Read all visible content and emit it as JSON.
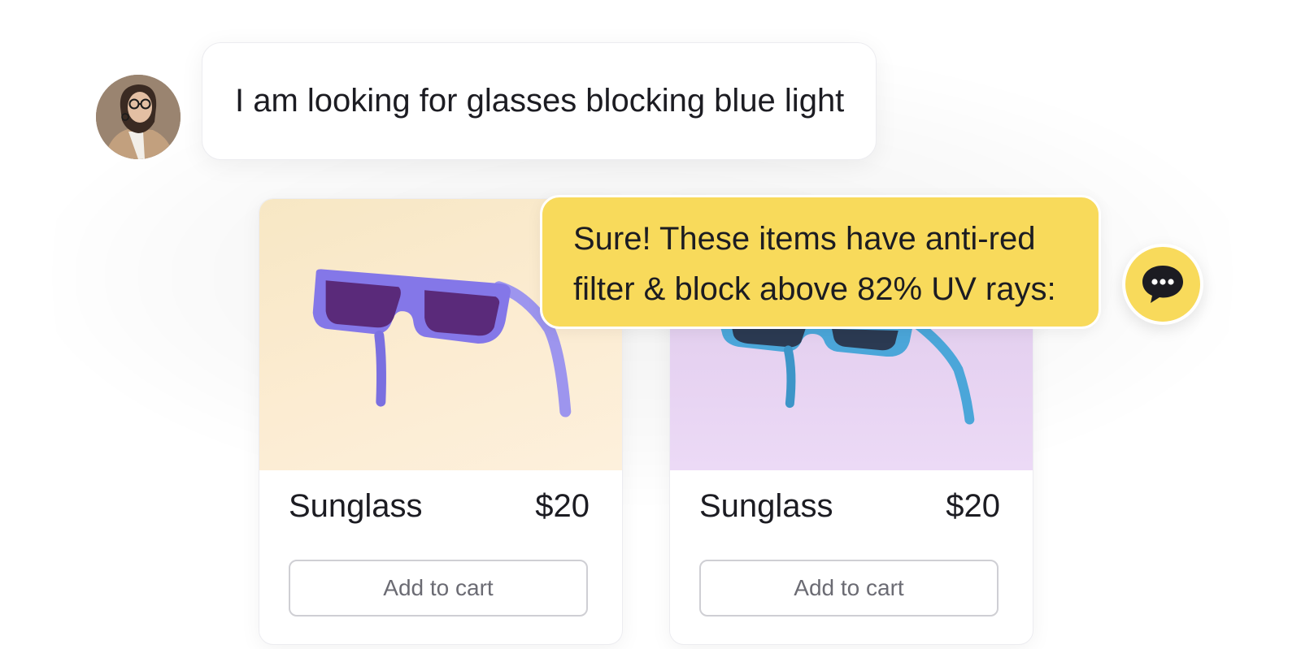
{
  "user_message": {
    "text": "I am looking for glasses blocking blue light"
  },
  "assistant_message": {
    "lines": [
      "Sure! These items have anti-red",
      "filter & block above 82% UV rays:"
    ]
  },
  "products": [
    {
      "name": "Sunglass",
      "price": "$20",
      "button_label": "Add to cart",
      "frame_color": "#8477e8",
      "lens_color": "#5a2a7a",
      "background": "peach"
    },
    {
      "name": "Sunglass",
      "price": "$20",
      "button_label": "Add to cart",
      "frame_color": "#4ba6d9",
      "lens_color": "#2b3a52",
      "background": "lavender"
    }
  ],
  "colors": {
    "accent": "#f8da5b",
    "text": "#1c1c22",
    "button_text": "#6b6b73"
  },
  "icons": {
    "chat_fab": "chat-bubble-icon",
    "avatar": "user-avatar"
  }
}
